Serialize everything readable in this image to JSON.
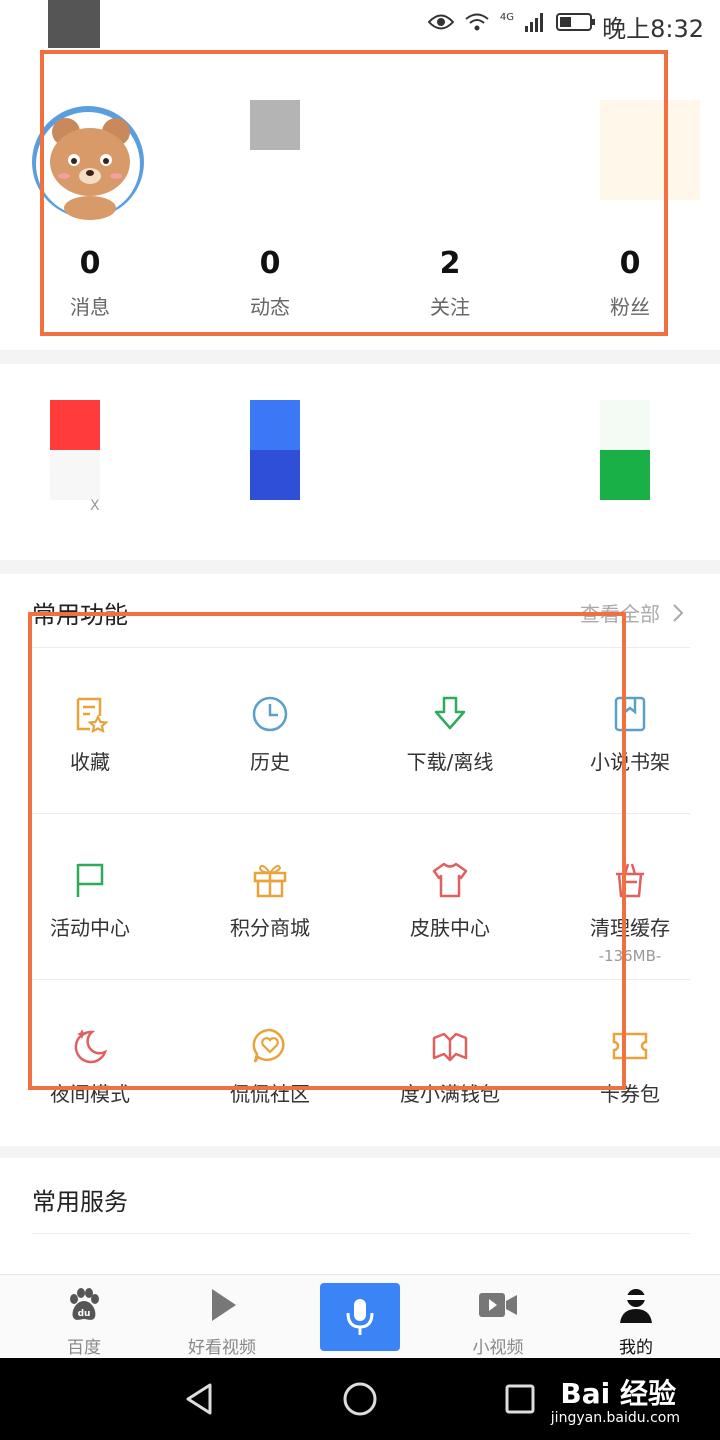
{
  "status_bar": {
    "time": "晚上8:32",
    "network": "4G"
  },
  "stats": [
    {
      "count": "0",
      "label": "消息"
    },
    {
      "count": "0",
      "label": "动态"
    },
    {
      "count": "2",
      "label": "关注"
    },
    {
      "count": "0",
      "label": "粉丝"
    }
  ],
  "quick_tiles": {
    "partial_label": "X"
  },
  "common_functions": {
    "title": "常用功能",
    "view_all": "查看全部",
    "items": [
      {
        "label": "收藏",
        "icon": "favorites-icon",
        "color": "#e8a33a"
      },
      {
        "label": "历史",
        "icon": "clock-icon",
        "color": "#5aa0c8"
      },
      {
        "label": "下载/离线",
        "icon": "download-arrow-icon",
        "color": "#2faa5a"
      },
      {
        "label": "小说书架",
        "icon": "bookmark-book-icon",
        "color": "#5aa0c8"
      },
      {
        "label": "活动中心",
        "icon": "flag-icon",
        "color": "#2faa5a"
      },
      {
        "label": "积分商城",
        "icon": "gift-icon",
        "color": "#e8a33a"
      },
      {
        "label": "皮肤中心",
        "icon": "tshirt-icon",
        "color": "#e06060"
      },
      {
        "label": "清理缓存",
        "sub": "-136MB-",
        "icon": "trash-icon",
        "color": "#e06060"
      },
      {
        "label": "夜间模式",
        "icon": "moon-icon",
        "color": "#e06060"
      },
      {
        "label": "侃侃社区",
        "icon": "chat-heart-icon",
        "color": "#e8a33a"
      },
      {
        "label": "度小满钱包",
        "icon": "wallet-icon",
        "color": "#e06060"
      },
      {
        "label": "卡券包",
        "icon": "ticket-icon",
        "color": "#e8a33a"
      }
    ]
  },
  "common_services": {
    "title": "常用服务"
  },
  "bottom_nav": [
    {
      "label": "百度",
      "icon": "paw-icon"
    },
    {
      "label": "好看视频",
      "icon": "play-icon"
    },
    {
      "label": "",
      "icon": "microphone-icon"
    },
    {
      "label": "小视频",
      "icon": "video-camera-icon"
    },
    {
      "label": "我的",
      "icon": "user-icon"
    }
  ],
  "watermark": {
    "main": "Bai 经验",
    "sub": "jingyan.baidu.com"
  },
  "colors": {
    "accent": "#3b84f5",
    "highlight_frame": "#f07040",
    "tile_red": "#ff3b3b",
    "tile_blue": "#2f5fe8",
    "tile_green": "#19b048"
  }
}
